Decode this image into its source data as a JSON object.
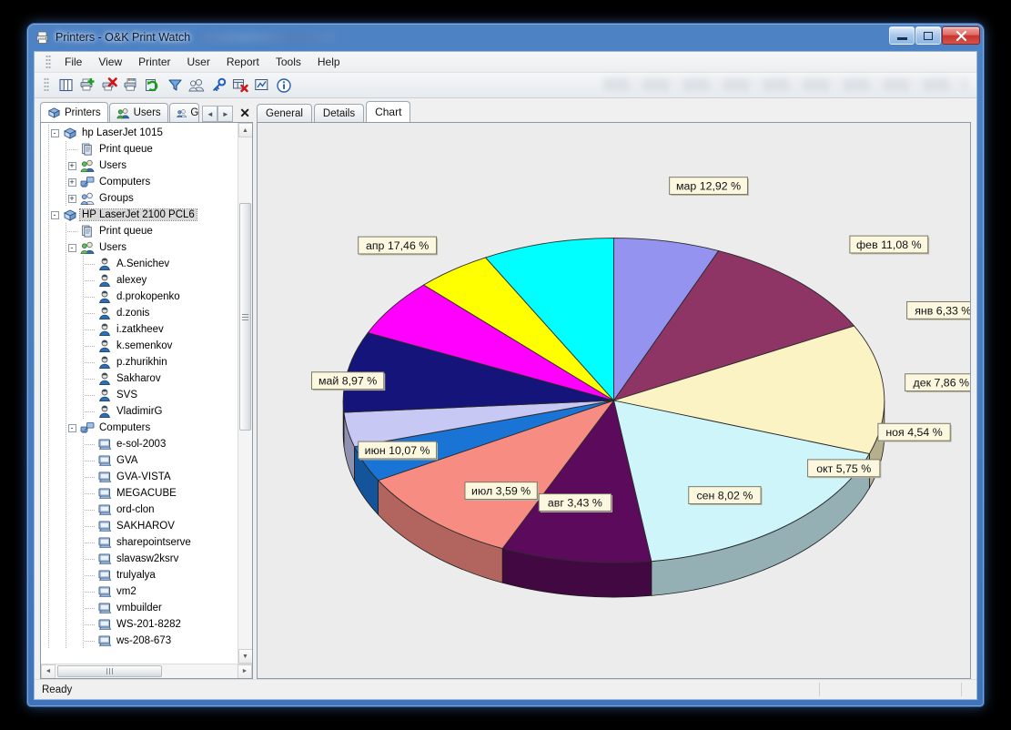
{
  "window": {
    "title": "Printers - O&K Print Watch",
    "title_icon": "printer-icon",
    "minimize_label": "Minimize",
    "maximize_label": "Restore",
    "close_label": "Close"
  },
  "menu": {
    "items": [
      {
        "label": "File"
      },
      {
        "label": "View"
      },
      {
        "label": "Printer"
      },
      {
        "label": "User"
      },
      {
        "label": "Report"
      },
      {
        "label": "Tools"
      },
      {
        "label": "Help"
      }
    ]
  },
  "toolbar": {
    "buttons": [
      {
        "name": "columns-icon",
        "title": "Columns"
      },
      {
        "name": "add-printer-icon",
        "title": "Add printer"
      },
      {
        "name": "delete-printer-icon",
        "title": "Delete printer"
      },
      {
        "name": "printer-properties-icon",
        "title": "Printer properties"
      },
      {
        "name": "refresh-icon",
        "title": "Refresh"
      },
      {
        "name": "filter-icon",
        "title": "Filter"
      },
      {
        "name": "users-icon",
        "title": "Users"
      },
      {
        "name": "key-icon",
        "title": "Permissions"
      },
      {
        "name": "remove-entry-icon",
        "title": "Remove entry"
      },
      {
        "name": "report-icon",
        "title": "Report"
      },
      {
        "name": "info-icon",
        "title": "About"
      }
    ]
  },
  "left_pane": {
    "tabs": [
      {
        "label": "Printers",
        "icon": "printer-icon",
        "active": true
      },
      {
        "label": "Users",
        "icon": "users-icon",
        "active": false
      },
      {
        "label": "G",
        "icon": "groups-icon",
        "active": false
      }
    ],
    "nav_prev": "◄",
    "nav_next": "►",
    "close_label": "✕",
    "tree": [
      {
        "label": "hp LaserJet 1015",
        "icon": "printer-icon",
        "depth": 0,
        "expander": "-",
        "selected": false
      },
      {
        "label": "Print queue",
        "icon": "queue-icon",
        "depth": 1,
        "expander": "",
        "selected": false
      },
      {
        "label": "Users",
        "icon": "users-icon",
        "depth": 1,
        "expander": "+",
        "selected": false
      },
      {
        "label": "Computers",
        "icon": "computers-icon",
        "depth": 1,
        "expander": "+",
        "selected": false
      },
      {
        "label": "Groups",
        "icon": "groups-icon",
        "depth": 1,
        "expander": "+",
        "selected": false
      },
      {
        "label": "HP LaserJet 2100 PCL6",
        "icon": "printer-icon",
        "depth": 0,
        "expander": "-",
        "selected": true
      },
      {
        "label": "Print queue",
        "icon": "queue-icon",
        "depth": 1,
        "expander": "",
        "selected": false
      },
      {
        "label": "Users",
        "icon": "users-icon",
        "depth": 1,
        "expander": "-",
        "selected": false
      },
      {
        "label": "A.Senichev",
        "icon": "user-icon",
        "depth": 2,
        "expander": "",
        "selected": false
      },
      {
        "label": "alexey",
        "icon": "user-icon",
        "depth": 2,
        "expander": "",
        "selected": false
      },
      {
        "label": "d.prokopenko",
        "icon": "user-icon",
        "depth": 2,
        "expander": "",
        "selected": false
      },
      {
        "label": "d.zonis",
        "icon": "user-icon",
        "depth": 2,
        "expander": "",
        "selected": false
      },
      {
        "label": "i.zatkheev",
        "icon": "user-icon",
        "depth": 2,
        "expander": "",
        "selected": false
      },
      {
        "label": "k.semenkov",
        "icon": "user-icon",
        "depth": 2,
        "expander": "",
        "selected": false
      },
      {
        "label": "p.zhurikhin",
        "icon": "user-icon",
        "depth": 2,
        "expander": "",
        "selected": false
      },
      {
        "label": "Sakharov",
        "icon": "user-icon",
        "depth": 2,
        "expander": "",
        "selected": false
      },
      {
        "label": "SVS",
        "icon": "user-icon",
        "depth": 2,
        "expander": "",
        "selected": false
      },
      {
        "label": "VladimirG",
        "icon": "user-icon",
        "depth": 2,
        "expander": "",
        "selected": false
      },
      {
        "label": "Computers",
        "icon": "computers-icon",
        "depth": 1,
        "expander": "-",
        "selected": false
      },
      {
        "label": "e-sol-2003",
        "icon": "computer-icon",
        "depth": 2,
        "expander": "",
        "selected": false
      },
      {
        "label": "GVA",
        "icon": "computer-icon",
        "depth": 2,
        "expander": "",
        "selected": false
      },
      {
        "label": "GVA-VISTA",
        "icon": "computer-icon",
        "depth": 2,
        "expander": "",
        "selected": false
      },
      {
        "label": "MEGACUBE",
        "icon": "computer-icon",
        "depth": 2,
        "expander": "",
        "selected": false
      },
      {
        "label": "ord-clon",
        "icon": "computer-icon",
        "depth": 2,
        "expander": "",
        "selected": false
      },
      {
        "label": "SAKHAROV",
        "icon": "computer-icon",
        "depth": 2,
        "expander": "",
        "selected": false
      },
      {
        "label": "sharepointserve",
        "icon": "computer-icon",
        "depth": 2,
        "expander": "",
        "selected": false
      },
      {
        "label": "slavasw2ksrv",
        "icon": "computer-icon",
        "depth": 2,
        "expander": "",
        "selected": false
      },
      {
        "label": "trulyalya",
        "icon": "computer-icon",
        "depth": 2,
        "expander": "",
        "selected": false
      },
      {
        "label": "vm2",
        "icon": "computer-icon",
        "depth": 2,
        "expander": "",
        "selected": false
      },
      {
        "label": "vmbuilder",
        "icon": "computer-icon",
        "depth": 2,
        "expander": "",
        "selected": false
      },
      {
        "label": "WS-201-8282",
        "icon": "computer-icon",
        "depth": 2,
        "expander": "",
        "selected": false
      },
      {
        "label": "ws-208-673",
        "icon": "computer-icon",
        "depth": 2,
        "expander": "",
        "selected": false
      }
    ],
    "scroll_up": "▲",
    "scroll_down": "▼",
    "scroll_left": "◄",
    "scroll_right": "►"
  },
  "right_pane": {
    "tabs": [
      {
        "label": "General",
        "active": false
      },
      {
        "label": "Details",
        "active": false
      },
      {
        "label": "Chart",
        "active": true
      }
    ]
  },
  "statusbar": {
    "text": "Ready"
  },
  "chart_data": {
    "type": "pie",
    "title": "",
    "unit": "%",
    "decimal_separator": ",",
    "legend_position": "callout-labels",
    "three_d": true,
    "categories": [
      "янв",
      "фев",
      "мар",
      "апр",
      "май",
      "июн",
      "июл",
      "авг",
      "сен",
      "окт",
      "ноя",
      "дек"
    ],
    "values": [
      6.33,
      11.08,
      12.92,
      17.46,
      8.97,
      10.07,
      3.59,
      3.43,
      8.02,
      5.75,
      4.54,
      7.86
    ],
    "colors": [
      "#9494f0",
      "#8e3566",
      "#fbf3c4",
      "#cdf5fa",
      "#5c0b5c",
      "#f78c83",
      "#1a74d6",
      "#c8c8f5",
      "#14147a",
      "#ff00ff",
      "#ffff00",
      "#00ffff"
    ],
    "labels": [
      {
        "category": "янв",
        "text": "янв 6,33 %",
        "value": 6.33
      },
      {
        "category": "фев",
        "text": "фев 11,08 %",
        "value": 11.08
      },
      {
        "category": "мар",
        "text": "мар 12,92 %",
        "value": 12.92
      },
      {
        "category": "апр",
        "text": "апр 17,46 %",
        "value": 17.46
      },
      {
        "category": "май",
        "text": "май 8,97 %",
        "value": 8.97
      },
      {
        "category": "июн",
        "text": "июн 10,07 %",
        "value": 10.07
      },
      {
        "category": "июл",
        "text": "июл 3,59 %",
        "value": 3.59
      },
      {
        "category": "авг",
        "text": "авг 3,43 %",
        "value": 3.43
      },
      {
        "category": "сен",
        "text": "сен 8,02 %",
        "value": 8.02
      },
      {
        "category": "окт",
        "text": "окт 5,75 %",
        "value": 5.75
      },
      {
        "category": "ноя",
        "text": "ноя 4,54 %",
        "value": 4.54
      },
      {
        "category": "дек",
        "text": "дек 7,86 %",
        "value": 7.86
      }
    ]
  }
}
